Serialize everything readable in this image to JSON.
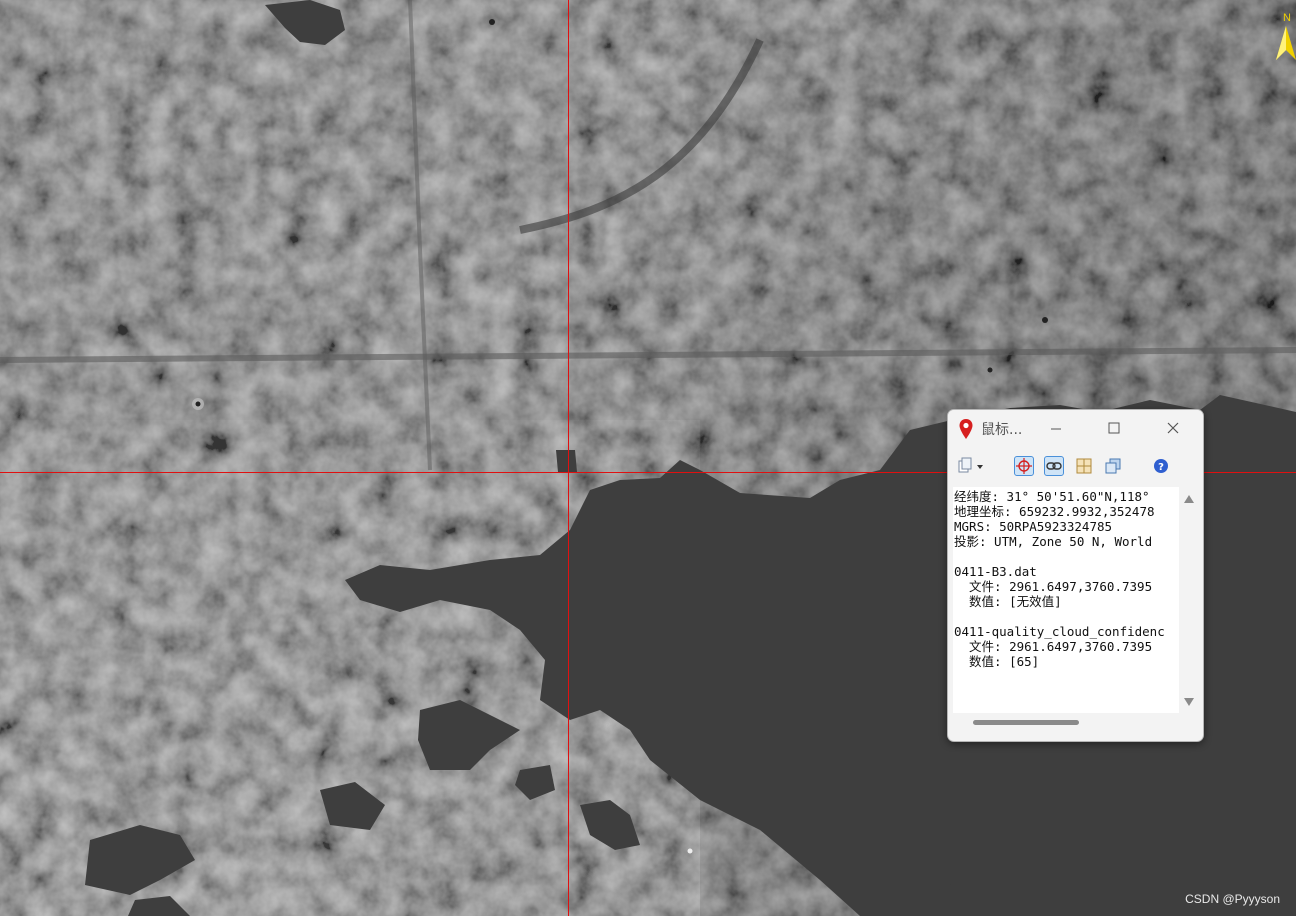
{
  "map": {
    "north_label": "N",
    "colors": {
      "land": "#777777",
      "water": "#3d3d3d",
      "crosshair": "#e01010",
      "north_arrow": "#f0d000"
    }
  },
  "dialog": {
    "title": "鼠标...",
    "toolbar_icons": [
      "copy-icon",
      "crosshair-target-icon",
      "link-icon",
      "grid-icon",
      "layers-icon",
      "help-icon"
    ],
    "lines": [
      "经纬度: 31° 50'51.60\"N,118°",
      "地理坐标: 659232.9932,352478",
      "MGRS: 50RPA5923324785",
      "投影: UTM, Zone 50 N, World",
      "",
      "0411-B3.dat",
      "  文件: 2961.6497,3760.7395",
      "  数值: [无效值]",
      "",
      "0411-quality_cloud_confidenc",
      "  文件: 2961.6497,3760.7395",
      "  数值: [65]"
    ]
  },
  "watermark": "CSDN @Pyyyson"
}
